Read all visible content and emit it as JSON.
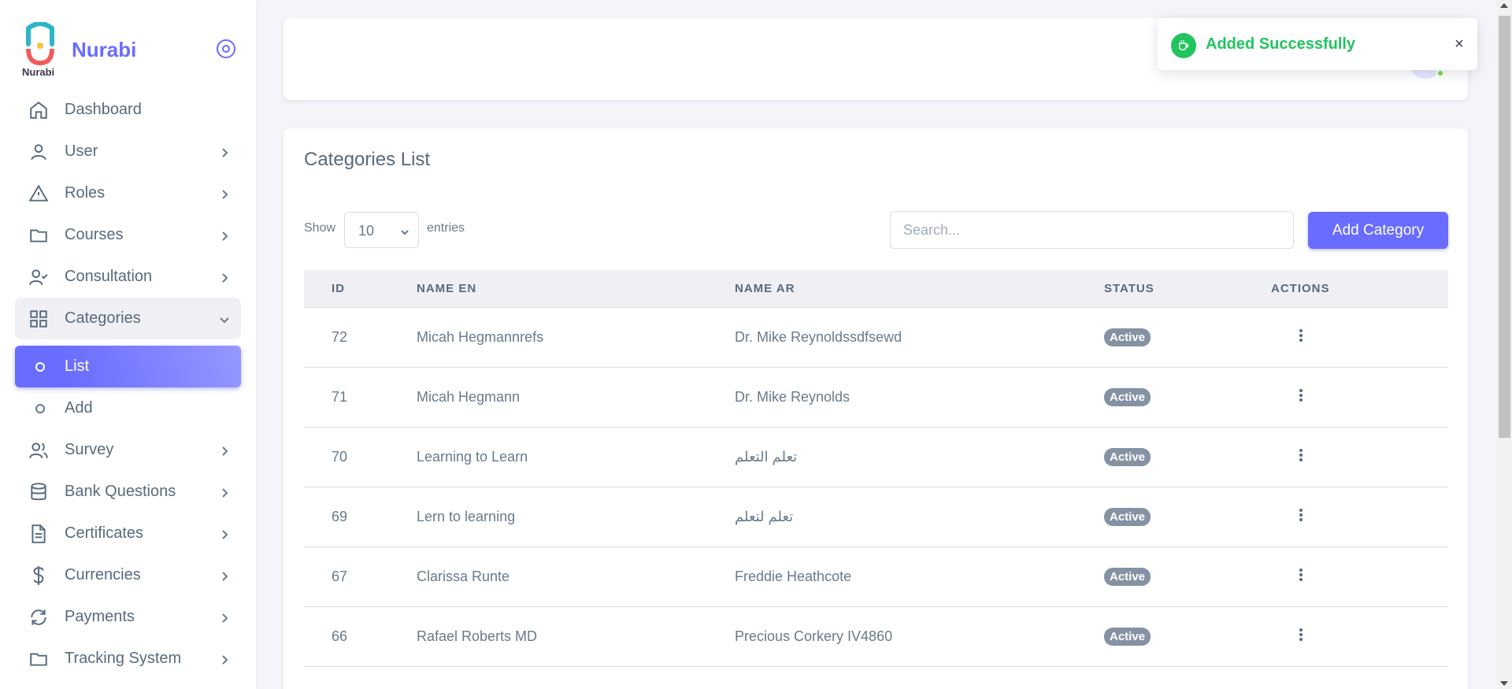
{
  "brand": {
    "name": "Nurabi",
    "logo_caption": "Nurabi",
    "accent": "#696cff"
  },
  "sidebar": {
    "items": [
      {
        "label": "Dashboard",
        "icon": "home-icon",
        "has_chevron": false
      },
      {
        "label": "User",
        "icon": "user-icon",
        "has_chevron": true
      },
      {
        "label": "Roles",
        "icon": "alert-triangle-icon",
        "has_chevron": true
      },
      {
        "label": "Courses",
        "icon": "folder-icon",
        "has_chevron": true
      },
      {
        "label": "Consultation",
        "icon": "user-check-icon",
        "has_chevron": true
      },
      {
        "label": "Categories",
        "icon": "grid-icon",
        "has_chevron": true,
        "open": true
      },
      {
        "label": "Survey",
        "icon": "users-icon",
        "has_chevron": true
      },
      {
        "label": "Bank Questions",
        "icon": "database-icon",
        "has_chevron": true
      },
      {
        "label": "Certificates",
        "icon": "file-text-icon",
        "has_chevron": true
      },
      {
        "label": "Currencies",
        "icon": "dollar-icon",
        "has_chevron": true
      },
      {
        "label": "Payments",
        "icon": "refresh-icon",
        "has_chevron": true
      },
      {
        "label": "Tracking System",
        "icon": "folder-icon",
        "has_chevron": true
      }
    ],
    "categories_sub": [
      {
        "label": "List",
        "active": true
      },
      {
        "label": "Add",
        "active": false
      }
    ]
  },
  "toast": {
    "message": "Added Successfully",
    "close": "×",
    "color": "#21c45d",
    "icon": "coffee-icon"
  },
  "card": {
    "title": "Categories List",
    "show_label": "Show",
    "entries_value": "10",
    "entries_label": "entries",
    "search_placeholder": "Search...",
    "add_button": "Add Category"
  },
  "table": {
    "columns": [
      "ID",
      "NAME EN",
      "NAME AR",
      "STATUS",
      "ACTIONS"
    ],
    "rows": [
      {
        "id": "72",
        "name_en": "Micah Hegmannrefs",
        "name_ar": "Dr. Mike Reynoldssdfsewd",
        "status": "Active"
      },
      {
        "id": "71",
        "name_en": "Micah Hegmann",
        "name_ar": "Dr. Mike Reynolds",
        "status": "Active"
      },
      {
        "id": "70",
        "name_en": "Learning to Learn",
        "name_ar": "تعلم التعلم",
        "status": "Active"
      },
      {
        "id": "69",
        "name_en": "Lern to learning",
        "name_ar": "تعلم لتعلم",
        "status": "Active"
      },
      {
        "id": "67",
        "name_en": "Clarissa Runte",
        "name_ar": "Freddie Heathcote",
        "status": "Active"
      },
      {
        "id": "66",
        "name_en": "Rafael Roberts MD",
        "name_ar": "Precious Corkery IV4860",
        "status": "Active"
      }
    ],
    "status_color": "#8592a3"
  }
}
